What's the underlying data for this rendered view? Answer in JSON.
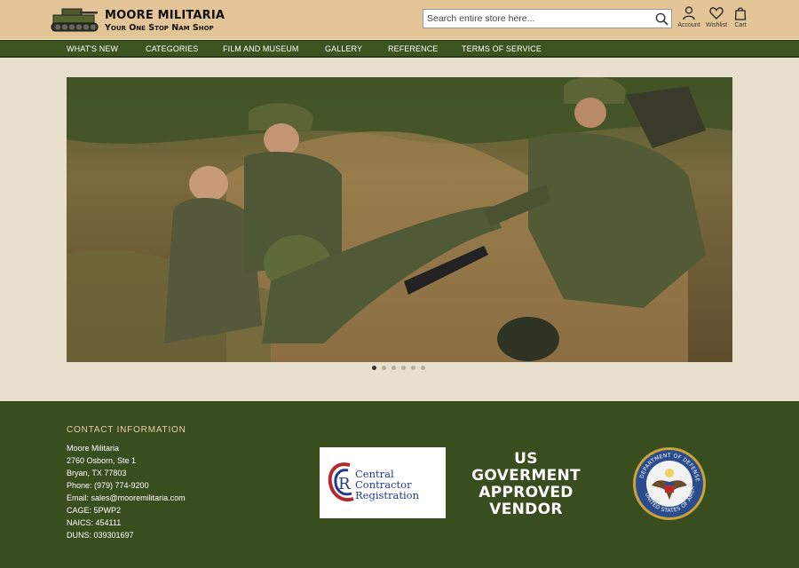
{
  "header": {
    "logo_title": "Moore Militaria",
    "logo_subtitle": "Your One Stop Nam Shop",
    "search_placeholder": "Search entire store here...",
    "icons": [
      {
        "name": "account-icon",
        "label": "Account"
      },
      {
        "name": "wishlist-icon",
        "label": "Wishlist"
      },
      {
        "name": "cart-icon",
        "label": "Cart"
      }
    ]
  },
  "nav": {
    "items": [
      "What's New",
      "Categories",
      "Film and Museum",
      "Gallery",
      "Reference",
      "Terms of Service"
    ]
  },
  "hero": {
    "slide_count": 6,
    "active_slide": 1,
    "image_description": "photo"
  },
  "footer": {
    "contact_title": "Contact Information",
    "contact_lines": [
      "Moore Militaria",
      "2760 Osborn, Ste 1",
      "Bryan, TX 77803",
      "Phone: (979) 774-9200",
      "Email: sales@mooremilitaria.com",
      "CAGE: 5PWP2",
      "NAICS: 454111",
      "DUNS: 039301697"
    ],
    "ccr_lines": [
      "Central",
      "Contractor",
      "Registration"
    ],
    "vendor_lines": [
      "US",
      "Goverment",
      "Approved",
      "Vendor"
    ],
    "seal_text": "Department of Defense • United States of America"
  },
  "colors": {
    "header_bg": "#e4c598",
    "nav_bg": "#3d5320",
    "page_bg": "#e8dfcd",
    "footer_bg": "#3a4d1e",
    "footer_title": "#e7cfa0"
  }
}
